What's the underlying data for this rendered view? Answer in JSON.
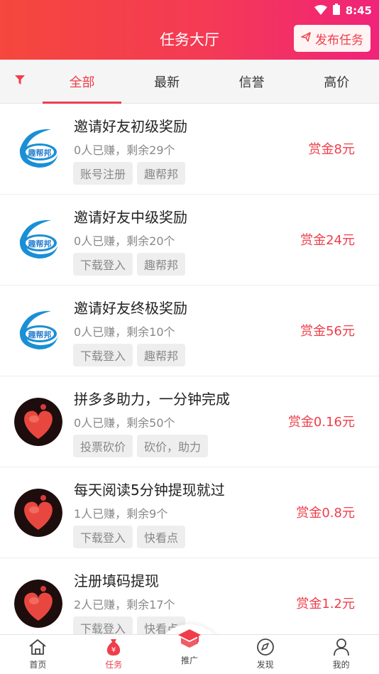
{
  "status": {
    "time": "8:45"
  },
  "header": {
    "title": "任务大厅",
    "publish_label": "发布任务"
  },
  "tabs": [
    {
      "label": "全部",
      "active": true
    },
    {
      "label": "最新",
      "active": false
    },
    {
      "label": "信誉",
      "active": false
    },
    {
      "label": "高价",
      "active": false
    }
  ],
  "tasks": [
    {
      "title": "邀请好友初级奖励",
      "meta": "0人已赚，剩余29个",
      "tags": [
        "账号注册",
        "趣帮邦"
      ],
      "reward": "赏金8元",
      "avatar": "qubangbang-logo"
    },
    {
      "title": "邀请好友中级奖励",
      "meta": "0人已赚，剩余20个",
      "tags": [
        "下载登入",
        "趣帮邦"
      ],
      "reward": "赏金24元",
      "avatar": "qubangbang-logo"
    },
    {
      "title": "邀请好友终极奖励",
      "meta": "0人已赚，剩余10个",
      "tags": [
        "下载登入",
        "趣帮邦"
      ],
      "reward": "赏金56元",
      "avatar": "qubangbang-logo"
    },
    {
      "title": "拼多多助力，一分钟完成",
      "meta": "0人已赚，剩余50个",
      "tags": [
        "投票砍价",
        "砍价，助力"
      ],
      "reward": "赏金0.16元",
      "avatar": "heart-avatar"
    },
    {
      "title": "每天阅读5分钟提现就过",
      "meta": "1人已赚，剩余9个",
      "tags": [
        "下载登入",
        "快看点"
      ],
      "reward": "赏金0.8元",
      "avatar": "heart-avatar"
    },
    {
      "title": "注册填码提现",
      "meta": "2人已赚，剩余17个",
      "tags": [
        "下载登入",
        "快看点"
      ],
      "reward": "赏金1.2元",
      "avatar": "heart-avatar"
    }
  ],
  "nav": [
    {
      "label": "首页",
      "icon": "home-icon"
    },
    {
      "label": "任务",
      "icon": "money-bag-icon",
      "active": true
    },
    {
      "label": "推广",
      "icon": "promote-icon"
    },
    {
      "label": "发现",
      "icon": "compass-icon"
    },
    {
      "label": "我的",
      "icon": "user-icon"
    }
  ],
  "logo_text": "趣帮邦",
  "colors": {
    "accent": "#ef3e4a",
    "header_start": "#f5473d",
    "header_end": "#f0237a"
  }
}
